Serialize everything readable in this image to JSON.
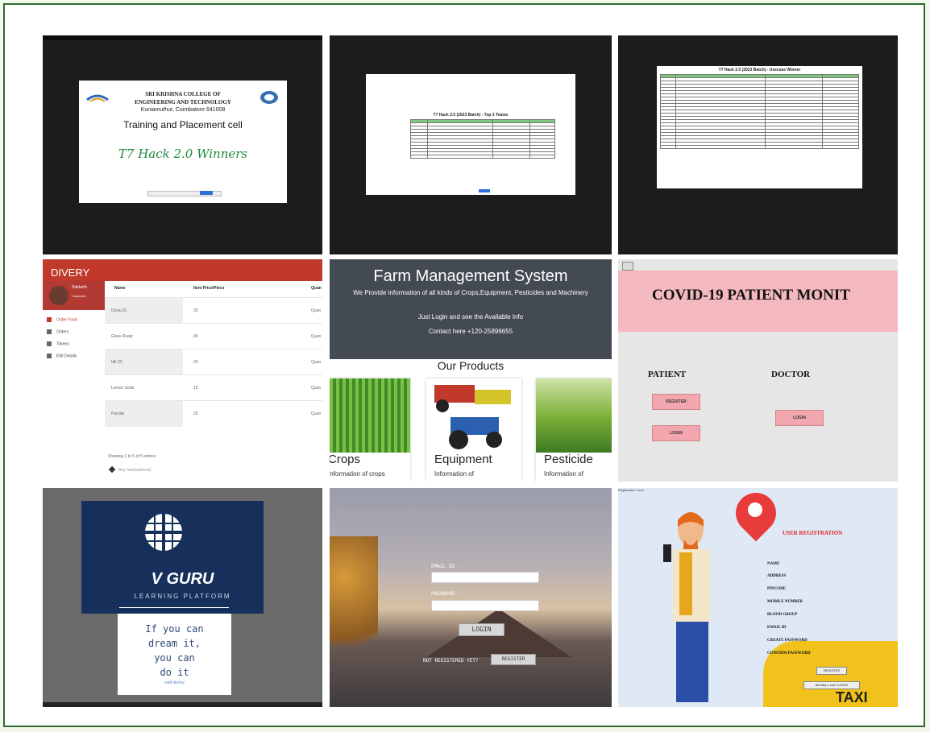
{
  "tile1": {
    "college_name_l1": "SRI KRISHNA COLLEGE OF",
    "college_name_l2": "ENGINEERING AND TECHNOLOGY",
    "college_address": "Kuniamuthur, Coimbatore 641008",
    "heading": "Training and Placement cell",
    "winners": "T7 Hack 2.0 Winners"
  },
  "tile2": {
    "table_title": "T7 Hack 2.0 (2023 Batch) - Top 3 Teams"
  },
  "tile3": {
    "table_title": "T7 Hack 2.0 (2023 Batch) - Usecase Winner"
  },
  "tile4": {
    "brand": "DIVERY",
    "user_name": "Siddarth",
    "user_role": "Customer",
    "menu": [
      "Order Food",
      "Orders",
      "Tokens",
      "Edit Details"
    ],
    "columns": [
      "Name",
      "Item Price/Piece",
      "Quan"
    ],
    "rows": [
      {
        "name": "Dosa (2)",
        "price": "30",
        "qty": "Quan"
      },
      {
        "name": "Ghee Roast",
        "price": "45",
        "qty": "Quan"
      },
      {
        "name": "Idli (2)",
        "price": "20",
        "qty": "Quan"
      },
      {
        "name": "Lemon Soda",
        "price": "15",
        "qty": "Quan"
      },
      {
        "name": "Parotta",
        "price": "25",
        "qty": "Quan"
      }
    ],
    "footer": "Showing 1 to 5 of 5 entries",
    "note_placeholder": "Any note(optional)"
  },
  "tile5": {
    "title": "Farm Management System",
    "line1": "We Provide information of all kinds of Crops,Equipment, Pesticides and Machinery",
    "line2": "Just Login and see the Available Info",
    "line3": "Contact here +120-25896655",
    "products_heading": "Our Products",
    "cards": [
      {
        "title": "Crops",
        "desc": "Information of crops"
      },
      {
        "title": "Equipment",
        "desc": "Information of"
      },
      {
        "title": "Pesticide",
        "desc": "Information of"
      }
    ]
  },
  "tile6": {
    "banner": "COVID-19 PATIENT MONIT",
    "patient": "PATIENT",
    "doctor": "DOCTOR",
    "register": "REGISTER",
    "login_patient": "LOGIN",
    "login_doctor": "LOGIN"
  },
  "tile7": {
    "brand": "V GURU",
    "tagline": "LEARNING PLATFORM",
    "quote_l1": "If you can",
    "quote_l2": "dream it,",
    "quote_l3": "you can",
    "quote_l4": "do it",
    "author": "walt disney"
  },
  "tile8": {
    "email_label": "EMAIL ID :",
    "password_label": "PASSWORD :",
    "login": "LOGIN",
    "not_registered": "NOT REGISTERED YET?",
    "register": "REGISTER"
  },
  "tile9": {
    "window_title": "Registration Form",
    "title": "USER REGISTRATION",
    "fields": [
      "NAME",
      "ADDRESS",
      "PINCODE",
      "MOBILE NUMBER",
      "BLOOD GROUP",
      "EMAIL ID",
      "CREATE PASSWORD",
      "CONFIRM PASSWORD"
    ],
    "register": "REGISTER",
    "login_link": "Already a user?LOGIN",
    "taxi": "TAXI"
  }
}
